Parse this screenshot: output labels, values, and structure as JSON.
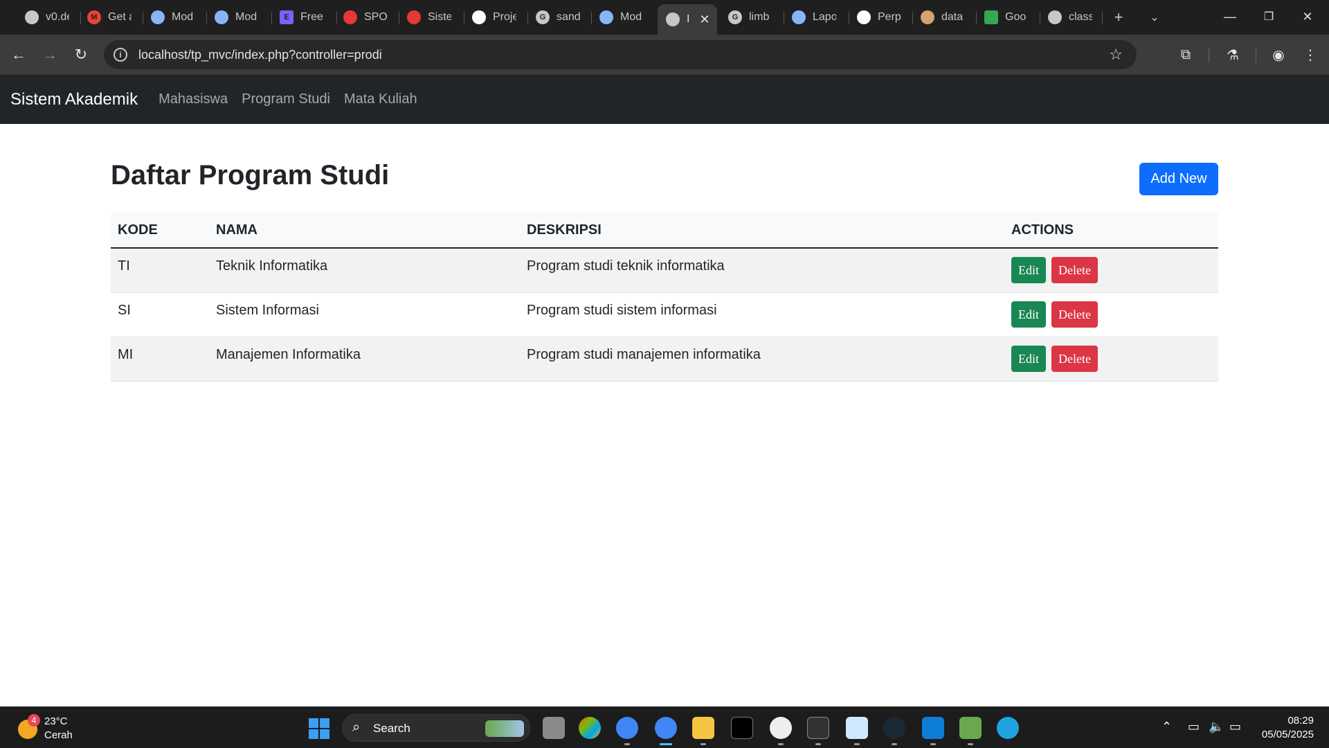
{
  "browser": {
    "tabs": [
      {
        "title": "v0.de",
        "favicon_color": "#c7c7c7"
      },
      {
        "title": "Get a",
        "favicon_color": "#ea4335"
      },
      {
        "title": "Mod",
        "favicon_color": "#8ab4f8"
      },
      {
        "title": "Mod",
        "favicon_color": "#8ab4f8"
      },
      {
        "title": "Free",
        "favicon_color": "#7b61ff"
      },
      {
        "title": "SPOT",
        "favicon_color": "#e53935"
      },
      {
        "title": "Siste",
        "favicon_color": "#e53935"
      },
      {
        "title": "Proje",
        "favicon_color": "#ffffff"
      },
      {
        "title": "sand",
        "favicon_color": "#c7c7c7"
      },
      {
        "title": "Mod",
        "favicon_color": "#8ab4f8"
      },
      {
        "title": "I",
        "favicon_color": "#c7c7c7"
      },
      {
        "title": "limb",
        "favicon_color": "#c7c7c7"
      },
      {
        "title": "Lapo",
        "favicon_color": "#8ab4f8"
      },
      {
        "title": "Perp",
        "favicon_color": "#ffffff"
      },
      {
        "title": "data",
        "favicon_color": "#d4a373"
      },
      {
        "title": "Goo",
        "favicon_color": "#34a853"
      },
      {
        "title": "class",
        "favicon_color": "#c7c7c7"
      }
    ],
    "address": "localhost/tp_mvc/index.php?controller=prodi"
  },
  "navbar": {
    "brand": "Sistem Akademik",
    "links": [
      "Mahasiswa",
      "Program Studi",
      "Mata Kuliah"
    ]
  },
  "page": {
    "title": "Daftar Program Studi",
    "add_label": "Add New",
    "columns": [
      "KODE",
      "NAMA",
      "DESKRIPSI",
      "ACTIONS"
    ],
    "rows": [
      {
        "kode": "TI",
        "nama": "Teknik Informatika",
        "deskripsi": "Program studi teknik informatika"
      },
      {
        "kode": "SI",
        "nama": "Sistem Informasi",
        "deskripsi": "Program studi sistem informasi"
      },
      {
        "kode": "MI",
        "nama": "Manajemen Informatika",
        "deskripsi": "Program studi manajemen informatika"
      }
    ],
    "edit_label": "Edit",
    "delete_label": "Delete"
  },
  "taskbar": {
    "weather_badge": "4",
    "temperature": "23°C",
    "condition": "Cerah",
    "search_label": "Search",
    "time": "08:29",
    "date": "05/05/2025"
  },
  "colors": {
    "primary": "#0d6efd",
    "success": "#198754",
    "danger": "#dc3545",
    "navbar": "#212529"
  }
}
